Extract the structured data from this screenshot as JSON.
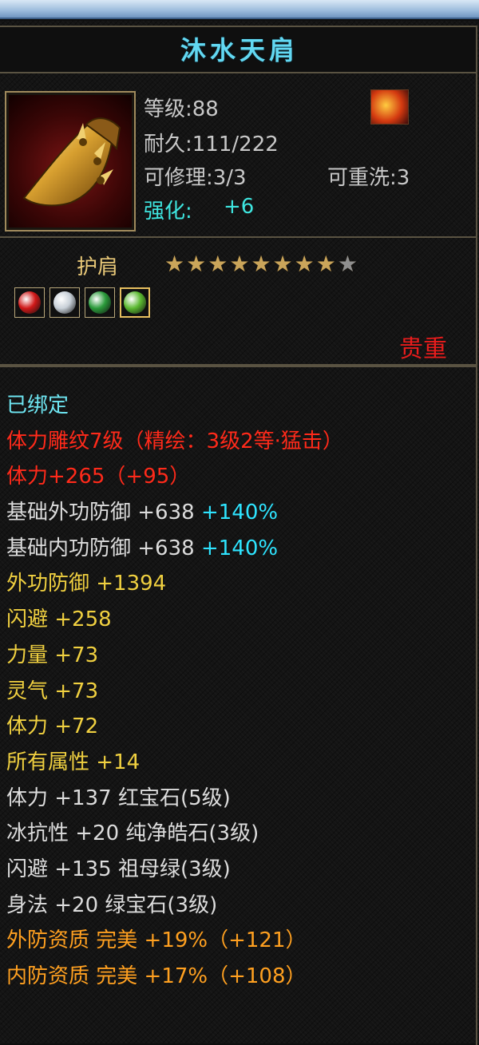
{
  "item": {
    "name": "沐水天肩",
    "level": "等级:88",
    "durability": "耐久:111/222",
    "repair": "可修理:3/3",
    "rewash": "可重洗:3",
    "enhance_label": "强化:",
    "enhance_value": "+6",
    "slot": "护肩",
    "stars_filled": 8,
    "stars_total": 9,
    "rarity": "贵重",
    "gem_colors": [
      "#d01818",
      "#c8d0d8",
      "#2a9a3a",
      "#5ab830"
    ]
  },
  "attributes": [
    {
      "text": "已绑定"
    },
    {
      "text": "体力雕纹7级（精绘：3级2等·猛击）"
    },
    {
      "text": "体力+265（+95）"
    },
    {
      "text": "基础外功防御 +638",
      "extra": "+140%"
    },
    {
      "text": "基础内功防御 +638",
      "extra": "+140%"
    },
    {
      "text": "外功防御 +1394"
    },
    {
      "text": "闪避 +258"
    },
    {
      "text": "力量 +73"
    },
    {
      "text": "灵气 +73"
    },
    {
      "text": "体力 +72"
    },
    {
      "text": "所有属性 +14"
    },
    {
      "text": "体力 +137 红宝石(5级)"
    },
    {
      "text": "冰抗性 +20 纯净皓石(3级)"
    },
    {
      "text": "闪避 +135 祖母绿(3级)"
    },
    {
      "text": "身法 +20 绿宝石(3级)"
    },
    {
      "text": "外防资质  完美 +19%（+121）"
    },
    {
      "text": "内防资质  完美 +17%（+108）"
    }
  ]
}
